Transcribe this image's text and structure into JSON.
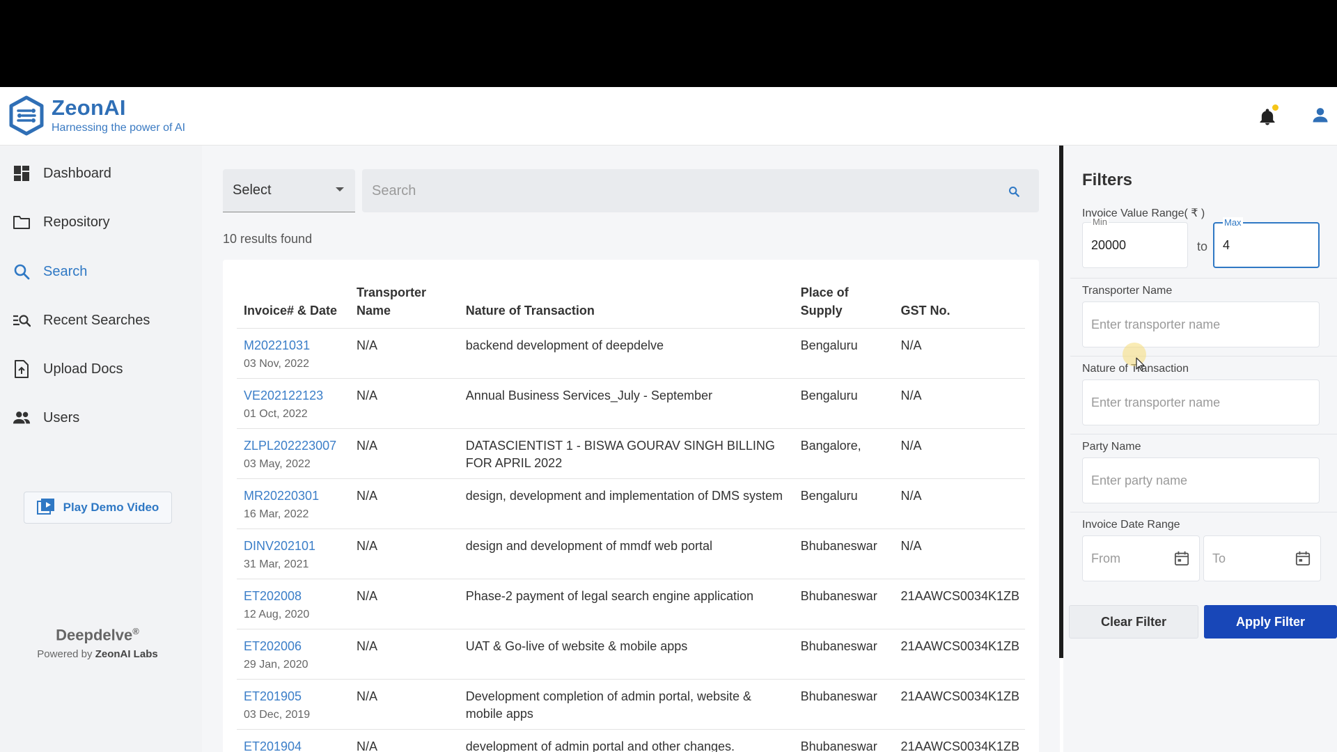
{
  "app": {
    "name": "ZeonAI",
    "tagline": "Harnessing the power of AI"
  },
  "sidebar": {
    "items": [
      {
        "label": "Dashboard",
        "icon": "dashboard-icon"
      },
      {
        "label": "Repository",
        "icon": "folder-icon"
      },
      {
        "label": "Search",
        "icon": "search-icon",
        "active": true
      },
      {
        "label": "Recent Searches",
        "icon": "recent-search-icon"
      },
      {
        "label": "Upload Docs",
        "icon": "upload-doc-icon"
      },
      {
        "label": "Users",
        "icon": "users-icon"
      }
    ],
    "demo_button": "Play Demo Video",
    "brand_name": "Deepdelve",
    "brand_mark": "®",
    "powered_prefix": "Powered by ",
    "powered_company": "ZeonAI Labs"
  },
  "toolbar": {
    "select_label": "Select",
    "search_placeholder": "Search"
  },
  "results_text": "10 results found",
  "table": {
    "headers": {
      "invoice": "Invoice# & Date",
      "transporter_1": "Transporter",
      "transporter_2": "Name",
      "nature": "Nature of Transaction",
      "place_1": "Place of",
      "place_2": "Supply",
      "gst": "GST No."
    },
    "rows": [
      {
        "invoice": "M20221031",
        "date": "03 Nov, 2022",
        "transporter": "N/A",
        "nature": "backend development of deepdelve",
        "place": "Bengaluru",
        "gst": "N/A"
      },
      {
        "invoice": "VE202122123",
        "date": "01 Oct, 2022",
        "transporter": "N/A",
        "nature": "Annual Business Services_July - September",
        "place": "Bengaluru",
        "gst": "N/A"
      },
      {
        "invoice": "ZLPL202223007",
        "date": "03 May, 2022",
        "transporter": "N/A",
        "nature": "DATASCIENTIST 1 - BISWA GOURAV SINGH BILLING FOR APRIL 2022",
        "place": "Bangalore,",
        "gst": "N/A"
      },
      {
        "invoice": "MR20220301",
        "date": "16 Mar, 2022",
        "transporter": "N/A",
        "nature": "design, development and implementation of DMS system",
        "place": "Bengaluru",
        "gst": "N/A"
      },
      {
        "invoice": "DINV202101",
        "date": "31 Mar, 2021",
        "transporter": "N/A",
        "nature": "design and development of mmdf web portal",
        "place": "Bhubaneswar",
        "gst": "N/A"
      },
      {
        "invoice": "ET202008",
        "date": "12 Aug, 2020",
        "transporter": "N/A",
        "nature": "Phase-2 payment of legal search engine application",
        "place": "Bhubaneswar",
        "gst": "21AAWCS0034K1ZB"
      },
      {
        "invoice": "ET202006",
        "date": "29 Jan, 2020",
        "transporter": "N/A",
        "nature": "UAT & Go-live of website & mobile apps",
        "place": "Bhubaneswar",
        "gst": "21AAWCS0034K1ZB"
      },
      {
        "invoice": "ET201905",
        "date": "03 Dec, 2019",
        "transporter": "N/A",
        "nature": "Development completion of admin portal, website & mobile apps",
        "place": "Bhubaneswar",
        "gst": "21AAWCS0034K1ZB"
      },
      {
        "invoice": "ET201904",
        "date": "",
        "transporter": "N/A",
        "nature": "development of admin portal and other changes.",
        "place": "Bhubaneswar",
        "gst": "21AAWCS0034K1ZB"
      }
    ]
  },
  "filters": {
    "title": "Filters",
    "value_range_label": "Invoice Value Range( ₹ )",
    "min_legend": "Min",
    "min_value": "20000",
    "to_label": "to",
    "max_legend": "Max",
    "max_value": "4",
    "transporter_label": "Transporter Name",
    "transporter_placeholder": "Enter transporter name",
    "nature_label": "Nature of Transaction",
    "nature_placeholder": "Enter transporter name",
    "party_label": "Party Name",
    "party_placeholder": "Enter party name",
    "date_range_label": "Invoice Date Range",
    "from_placeholder": "From",
    "to_placeholder": "To",
    "clear_button": "Clear Filter",
    "apply_button": "Apply Filter"
  },
  "colors": {
    "brand": "#2f6fb6",
    "link": "#3b7ec8",
    "apply": "#1847b8",
    "notification_dot": "#f5c518"
  }
}
